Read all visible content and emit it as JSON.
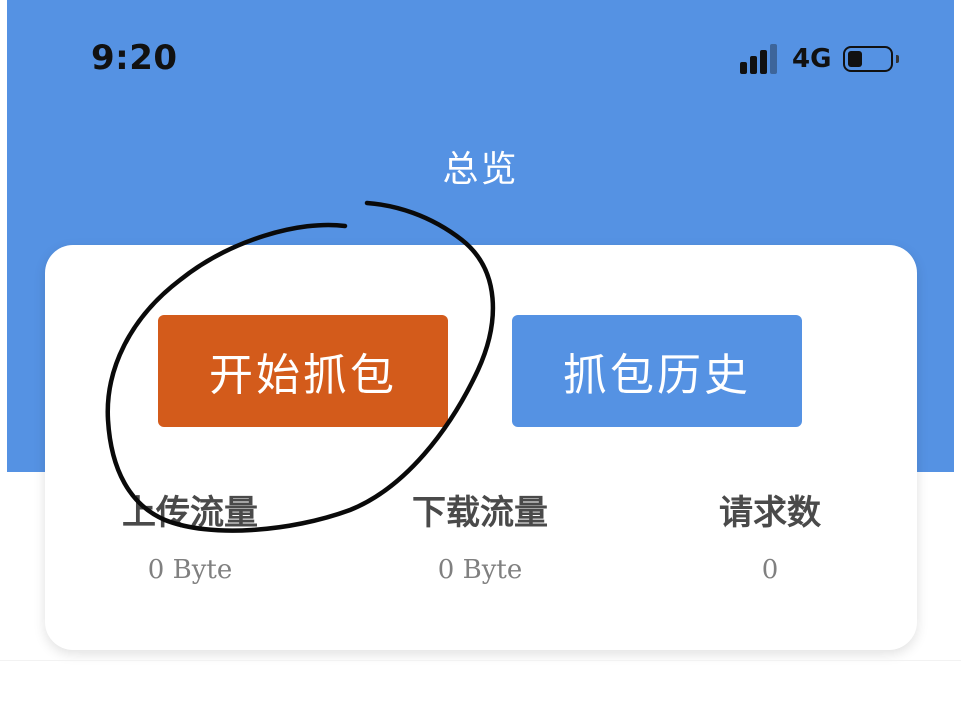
{
  "colors": {
    "header_blue": "#5592e3",
    "start_button": "#d35b1b",
    "history_button": "#5592e3"
  },
  "status_bar": {
    "time": "9:20",
    "network": "4G",
    "battery_level": 0.35,
    "icons": [
      "signal-icon",
      "battery-icon"
    ]
  },
  "nav": {
    "title": "总览"
  },
  "actions": {
    "start_capture": "开始抓包",
    "capture_history": "抓包历史"
  },
  "stats": [
    {
      "label": "上传流量",
      "value": "0 Byte"
    },
    {
      "label": "下载流量",
      "value": "0 Byte"
    },
    {
      "label": "请求数",
      "value": "0"
    }
  ]
}
